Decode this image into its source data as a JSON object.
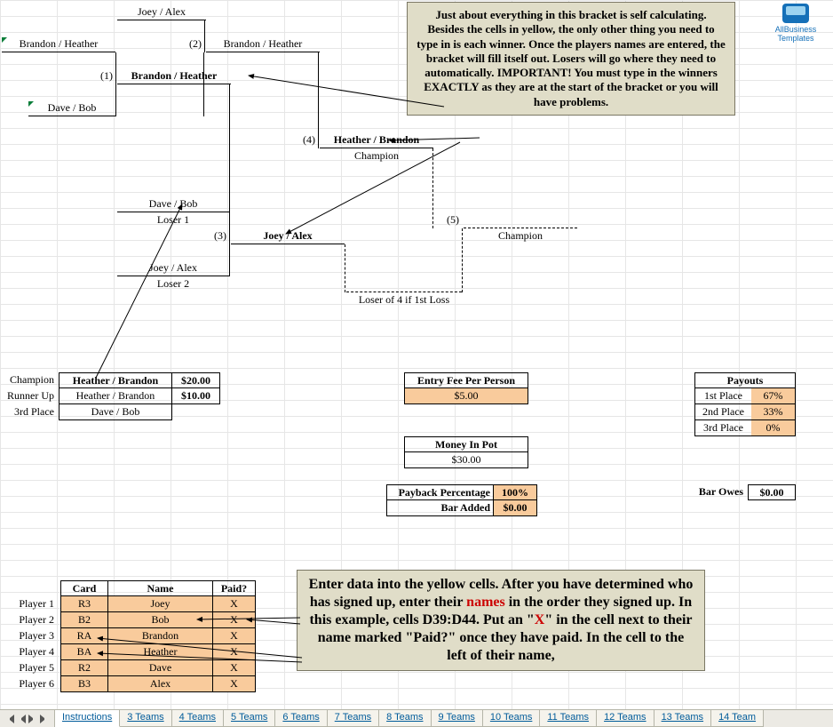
{
  "logo_text": "AllBusiness\nTemplates",
  "bracket": {
    "r1_top_a": "Joey / Alex",
    "r1_top_b": "Brandon / Heather",
    "r1_bot": "Dave / Bob",
    "r1_seed1": "(1)",
    "r1_seed2": "(2)",
    "r2_winner": "Brandon / Heather",
    "r2_seed4_label": "(4)",
    "r2_seed4_team": "Heather / Brandon",
    "r2_champ_label": "Champion",
    "loser1_team": "Dave / Bob",
    "loser1_label": "Loser 1",
    "r3_seed": "(3)",
    "r3_team": "Joey / Alex",
    "loser2_team": "Joey / Alex",
    "loser2_label": "Loser 2",
    "r5_seed": "(5)",
    "r5_champ": "Champion",
    "loser4_label": "Loser of 4 if 1st Loss"
  },
  "results": {
    "champ_label": "Champion",
    "champ_team": "Heather / Brandon",
    "champ_pay": "$20.00",
    "runner_label": "Runner Up",
    "runner_team": "Heather / Brandon",
    "runner_pay": "$10.00",
    "third_label": "3rd Place",
    "third_team": "Dave / Bob"
  },
  "finance": {
    "entry_label": "Entry Fee Per Person",
    "entry_val": "$5.00",
    "pot_label": "Money In Pot",
    "pot_val": "$30.00",
    "payback_label": "Payback Percentage",
    "payback_val": "100%",
    "baradded_label": "Bar Added",
    "baradded_val": "$0.00",
    "barowes_label": "Bar Owes",
    "barowes_val": "$0.00"
  },
  "payouts": {
    "header": "Payouts",
    "rows": [
      {
        "place": "1st Place",
        "pct": "67%"
      },
      {
        "place": "2nd Place",
        "pct": "33%"
      },
      {
        "place": "3rd Place",
        "pct": "0%"
      }
    ]
  },
  "players": {
    "h_card": "Card",
    "h_name": "Name",
    "h_paid": "Paid?",
    "rows": [
      {
        "label": "Player 1",
        "card": "R3",
        "name": "Joey",
        "paid": "X"
      },
      {
        "label": "Player 2",
        "card": "B2",
        "name": "Bob",
        "paid": "X"
      },
      {
        "label": "Player 3",
        "card": "RA",
        "name": "Brandon",
        "paid": "X"
      },
      {
        "label": "Player 4",
        "card": "BA",
        "name": "Heather",
        "paid": "X"
      },
      {
        "label": "Player 5",
        "card": "R2",
        "name": "Dave",
        "paid": "X"
      },
      {
        "label": "Player 6",
        "card": "B3",
        "name": "Alex",
        "paid": "X"
      }
    ]
  },
  "callout_top": "Just about everything in this bracket is self calculating. Besides the cells in yellow, the only other thing you need to type in is each winner. Once the players names are entered, the bracket will fill itself out. Losers will go where they need to automatically. IMPORTANT! You must type in the winners EXACTLY as they are at the start of the bracket or you will have problems.",
  "callout_bottom_a": "Enter data into the yellow cells. After you have determined who has signed up, enter their ",
  "callout_bottom_b": "names",
  "callout_bottom_c": " in the order they signed up. In this example, cells D39:D44. Put an \"",
  "callout_bottom_d": "X",
  "callout_bottom_e": "\" in the cell next to their name marked \"Paid?\" once they have paid. In the cell to the left of their name,",
  "tabs": [
    "Instructions",
    "3 Teams",
    "4 Teams",
    "5 Teams",
    "6 Teams",
    "7 Teams",
    "8 Teams",
    "9 Teams",
    "10 Teams",
    "11 Teams",
    "12 Teams",
    "13 Teams",
    "14 Team"
  ]
}
